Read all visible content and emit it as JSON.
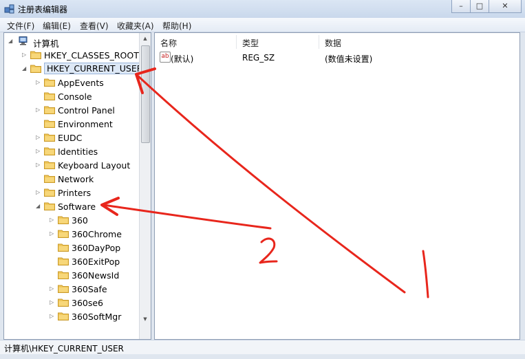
{
  "window": {
    "title": "注册表编辑器"
  },
  "menu": [
    "文件(F)",
    "编辑(E)",
    "查看(V)",
    "收藏夹(A)",
    "帮助(H)"
  ],
  "tree": {
    "root": "计算机",
    "items": [
      {
        "label": "HKEY_CLASSES_ROOT",
        "level": 1,
        "expander": "collapsed"
      },
      {
        "label": "HKEY_CURRENT_USER",
        "level": 1,
        "expander": "expanded",
        "selected": true
      },
      {
        "label": "AppEvents",
        "level": 2,
        "expander": "collapsed"
      },
      {
        "label": "Console",
        "level": 2,
        "expander": "none"
      },
      {
        "label": "Control Panel",
        "level": 2,
        "expander": "collapsed"
      },
      {
        "label": "Environment",
        "level": 2,
        "expander": "none"
      },
      {
        "label": "EUDC",
        "level": 2,
        "expander": "collapsed"
      },
      {
        "label": "Identities",
        "level": 2,
        "expander": "collapsed"
      },
      {
        "label": "Keyboard Layout",
        "level": 2,
        "expander": "collapsed"
      },
      {
        "label": "Network",
        "level": 2,
        "expander": "none"
      },
      {
        "label": "Printers",
        "level": 2,
        "expander": "collapsed"
      },
      {
        "label": "Software",
        "level": 2,
        "expander": "expanded"
      },
      {
        "label": "360",
        "level": 3,
        "expander": "collapsed"
      },
      {
        "label": "360Chrome",
        "level": 3,
        "expander": "collapsed"
      },
      {
        "label": "360DayPop",
        "level": 3,
        "expander": "none"
      },
      {
        "label": "360ExitPop",
        "level": 3,
        "expander": "none"
      },
      {
        "label": "360NewsId",
        "level": 3,
        "expander": "none"
      },
      {
        "label": "360Safe",
        "level": 3,
        "expander": "collapsed"
      },
      {
        "label": "360se6",
        "level": 3,
        "expander": "collapsed"
      },
      {
        "label": "360SoftMgr",
        "level": 3,
        "expander": "collapsed"
      }
    ]
  },
  "list": {
    "columns": [
      "名称",
      "类型",
      "数据"
    ],
    "rows": [
      {
        "icon": "ab",
        "name": "(默认)",
        "type": "REG_SZ",
        "data": "(数值未设置)"
      }
    ]
  },
  "status": {
    "path": "计算机\\HKEY_CURRENT_USER"
  },
  "annotations": {
    "label1": "1",
    "label2": "2",
    "color": "#e8261c"
  },
  "icons": {
    "app": "regedit-icon",
    "computer": "computer-icon",
    "folder": "folder-icon",
    "value": "string-value-icon"
  }
}
